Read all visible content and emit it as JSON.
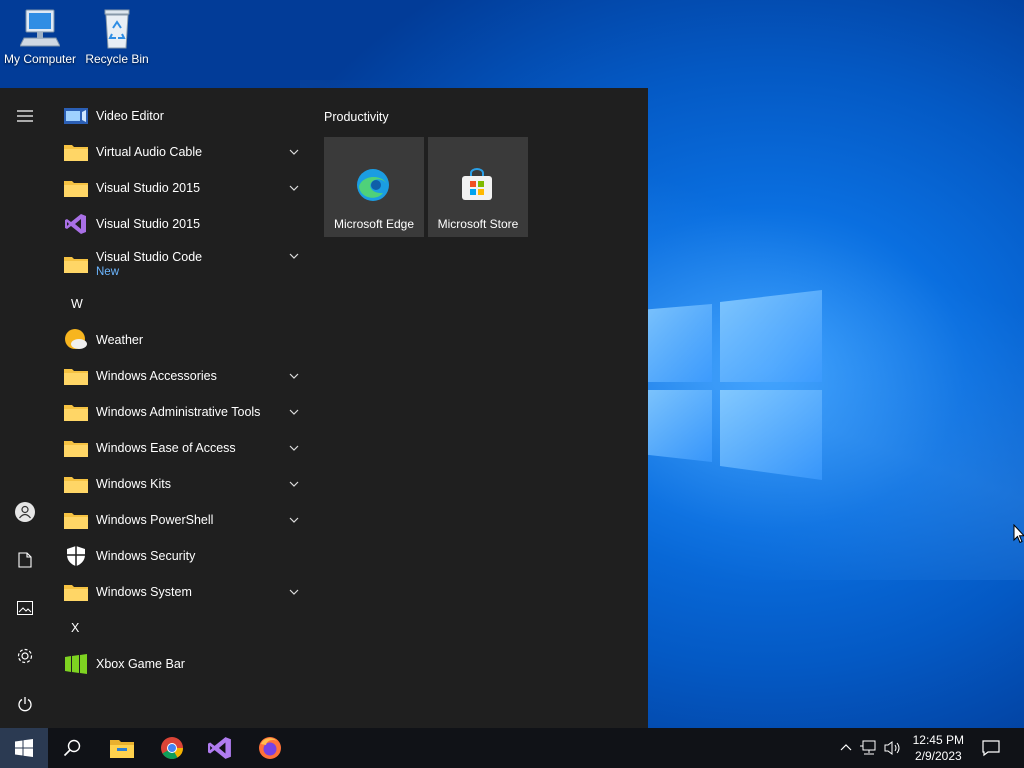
{
  "desktop": {
    "icons": [
      {
        "label": "My Computer",
        "icon": "computer-icon"
      },
      {
        "label": "Recycle Bin",
        "icon": "recycle-bin-icon"
      }
    ]
  },
  "start_menu": {
    "apps": [
      {
        "label": "Video Editor",
        "icon": "video-editor-icon",
        "expandable": false
      },
      {
        "label": "Virtual Audio Cable",
        "icon": "folder-icon",
        "expandable": true
      },
      {
        "label": "Visual Studio 2015",
        "icon": "folder-icon",
        "expandable": true
      },
      {
        "label": "Visual Studio 2015",
        "icon": "visual-studio-icon",
        "expandable": false
      },
      {
        "label": "Visual Studio Code",
        "sub": "New",
        "icon": "folder-icon",
        "expandable": true
      },
      {
        "letter": "W"
      },
      {
        "label": "Weather",
        "icon": "weather-icon",
        "expandable": false
      },
      {
        "label": "Windows Accessories",
        "icon": "folder-icon",
        "expandable": true
      },
      {
        "label": "Windows Administrative Tools",
        "icon": "folder-icon",
        "expandable": true
      },
      {
        "label": "Windows Ease of Access",
        "icon": "folder-icon",
        "expandable": true
      },
      {
        "label": "Windows Kits",
        "icon": "folder-icon",
        "expandable": true
      },
      {
        "label": "Windows PowerShell",
        "icon": "folder-icon",
        "expandable": true
      },
      {
        "label": "Windows Security",
        "icon": "shield-icon",
        "expandable": false
      },
      {
        "label": "Windows System",
        "icon": "folder-icon",
        "expandable": true
      },
      {
        "letter": "X"
      },
      {
        "label": "Xbox Game Bar",
        "icon": "xbox-game-bar-icon",
        "expandable": false
      }
    ],
    "group_title": "Productivity",
    "tiles": [
      {
        "label": "Microsoft Edge",
        "icon": "edge-icon"
      },
      {
        "label": "Microsoft Store",
        "icon": "store-icon"
      }
    ],
    "rail": [
      "hamburger-menu-icon",
      "user-icon",
      "documents-icon",
      "pictures-icon",
      "settings-icon",
      "power-icon"
    ]
  },
  "taskbar": {
    "pinned": [
      "search-icon",
      "file-explorer-icon",
      "chrome-icon",
      "visual-studio-icon",
      "firefox-icon"
    ],
    "tray_icons": [
      "chevron-up-icon",
      "network-icon",
      "volume-icon"
    ],
    "time": "12:45 PM",
    "date": "2/9/2023",
    "notification_icon": "action-center-icon"
  },
  "colors": {
    "start_bg": "#1f1f1f",
    "tile_bg": "#3a3a3a",
    "accent_new": "#6cb6ff",
    "taskbar_bg": "#101217"
  }
}
